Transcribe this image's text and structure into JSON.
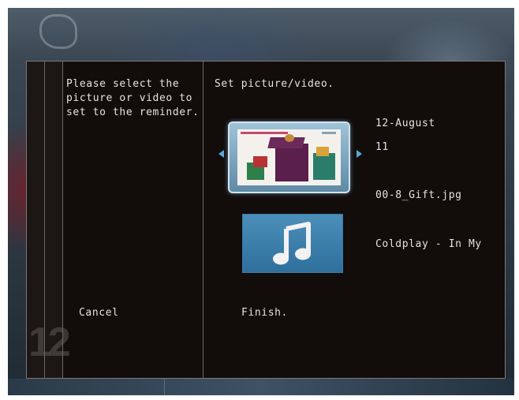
{
  "dialog": {
    "instruction_lines": [
      "Please select the",
      "picture or video to",
      "set to the reminder."
    ],
    "title": "Set picture/video.",
    "date": "12-August",
    "year": "11",
    "filename": "00-8_Gift.jpg",
    "music": "Coldplay - In My",
    "cancel_label": "Cancel",
    "finish_label": "Finish.",
    "strip_number": "12"
  },
  "icons": {
    "prev": "arrow-left-icon",
    "next": "arrow-right-icon",
    "music": "music-note-icon"
  },
  "colors": {
    "accent": "#5aa8d8",
    "dialog_bg": "#120c0b",
    "text": "#e6e3df"
  }
}
